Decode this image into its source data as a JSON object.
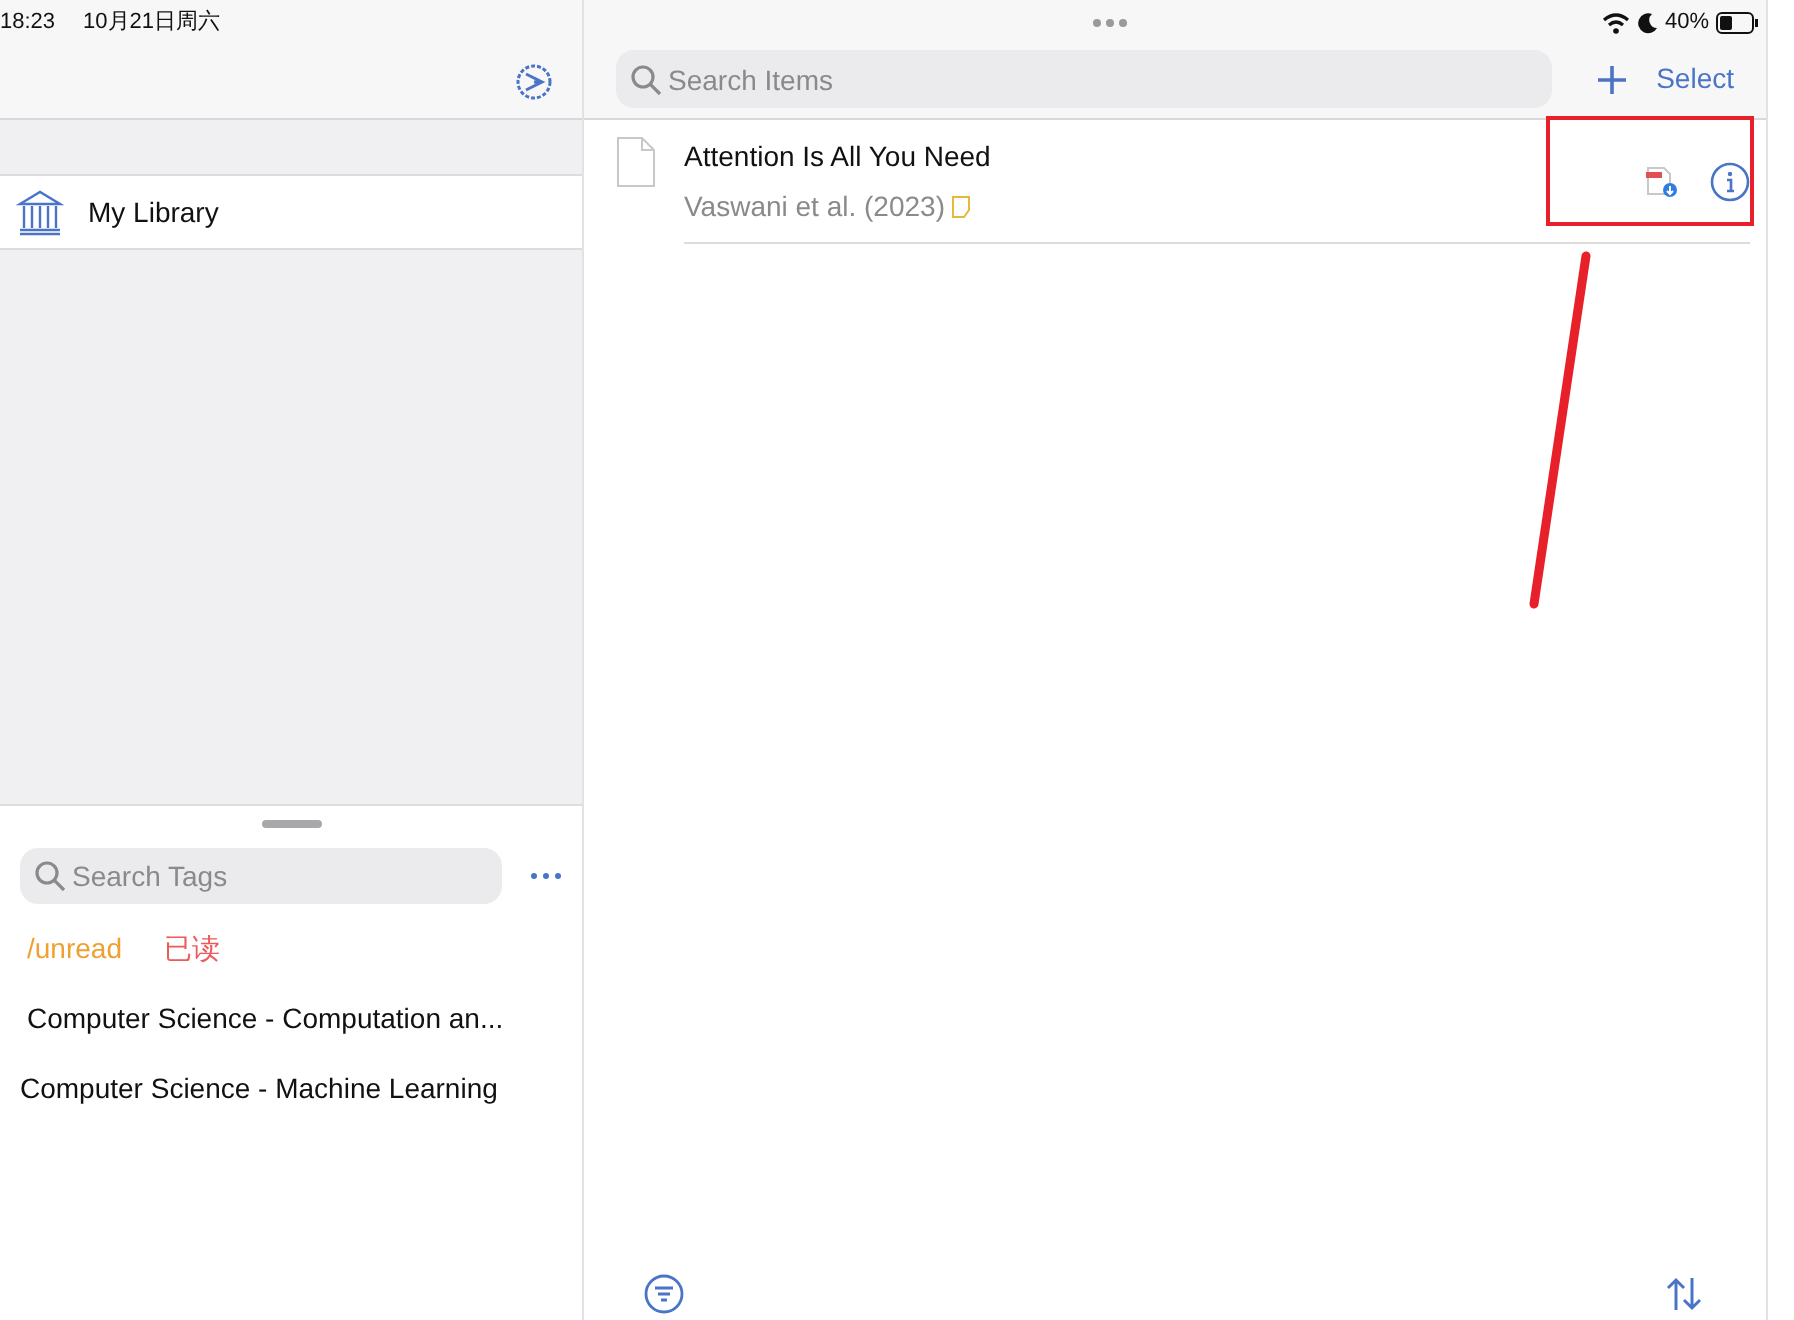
{
  "status_bar": {
    "time": "18:23",
    "date": "10月21日周六",
    "battery": "40%"
  },
  "sidebar": {
    "items": [
      {
        "label": "My Library",
        "selected": false
      }
    ]
  },
  "tags_panel": {
    "search": {
      "placeholder": "Search Tags"
    },
    "colored_tags": [
      {
        "label": "/unread",
        "color": "#f0a030"
      },
      {
        "label": "已读",
        "color": "#ec5a5a"
      }
    ],
    "tags": [
      "Computer Science - Computation an...",
      "Computer Science - Machine Learning"
    ]
  },
  "items_toolbar": {
    "search": {
      "placeholder": "Search Items"
    },
    "select_label": "Select"
  },
  "items": [
    {
      "title": "Attention Is All You Need",
      "subtitle": "Vaswani et al. (2023)",
      "has_note": true,
      "has_pdf": true
    }
  ]
}
